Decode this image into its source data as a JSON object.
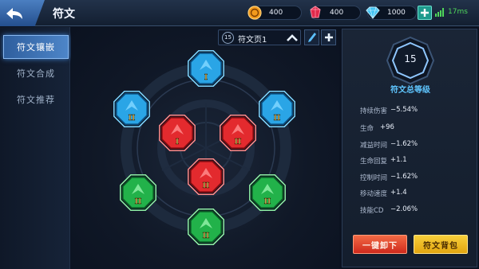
{
  "header": {
    "title": "符文",
    "gold": "400",
    "ruby": "400",
    "diamond": "1000",
    "ping": "17ms"
  },
  "sidebar": {
    "items": [
      {
        "label": "符文镶嵌",
        "active": true
      },
      {
        "label": "符文合成",
        "active": false
      },
      {
        "label": "符文推荐",
        "active": false
      }
    ]
  },
  "rune_page": {
    "number": "15",
    "name": "符文页1"
  },
  "rune_slots": [
    {
      "color": "blue",
      "tier": "I"
    },
    {
      "color": "blue",
      "tier": "II"
    },
    {
      "color": "blue",
      "tier": "II"
    },
    {
      "color": "red",
      "tier": "I"
    },
    {
      "color": "red",
      "tier": "II"
    },
    {
      "color": "red",
      "tier": "II"
    },
    {
      "color": "green",
      "tier": "II"
    },
    {
      "color": "green",
      "tier": "II"
    },
    {
      "color": "green",
      "tier": "II"
    }
  ],
  "stats_panel": {
    "level": "15",
    "level_title": "符文总等级",
    "stats": [
      {
        "label": "持续伤害",
        "value": "−5.54%"
      },
      {
        "label": "生命",
        "value": "+96"
      },
      {
        "label": "减益时间",
        "value": "−1.62%"
      },
      {
        "label": "生命回复",
        "value": "+1.1"
      },
      {
        "label": "控制时间",
        "value": "−1.62%"
      },
      {
        "label": "移动速度",
        "value": "+1.4"
      },
      {
        "label": "技能CD",
        "value": "−2.06%"
      }
    ],
    "unequip_label": "一键卸下",
    "bag_label": "符文背包"
  },
  "colors": {
    "blue": "#2aa5e6",
    "red": "#e32a2e",
    "green": "#22b24a",
    "accent": "#5fc6ff"
  }
}
